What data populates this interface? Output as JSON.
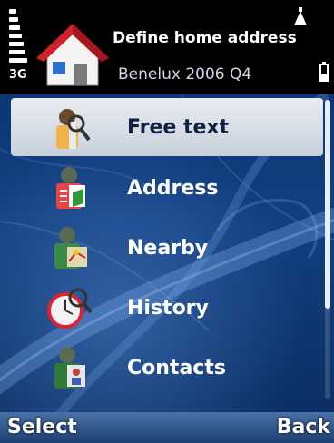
{
  "status": {
    "network": "3G"
  },
  "header": {
    "title": "Define home address",
    "subtitle": "Benelux 2006 Q4"
  },
  "menu": {
    "items": [
      {
        "label": "Free text",
        "icon": "search-person-icon",
        "selected": true
      },
      {
        "label": "Address",
        "icon": "address-book-icon",
        "selected": false
      },
      {
        "label": "Nearby",
        "icon": "nearby-map-icon",
        "selected": false
      },
      {
        "label": "History",
        "icon": "history-clock-icon",
        "selected": false
      },
      {
        "label": "Contacts",
        "icon": "contacts-icon",
        "selected": false
      }
    ]
  },
  "softkeys": {
    "left": "Select",
    "right": "Back"
  },
  "colors": {
    "background": "#123f82",
    "selection": "#dfe4eb",
    "roof": "#d0202a"
  }
}
